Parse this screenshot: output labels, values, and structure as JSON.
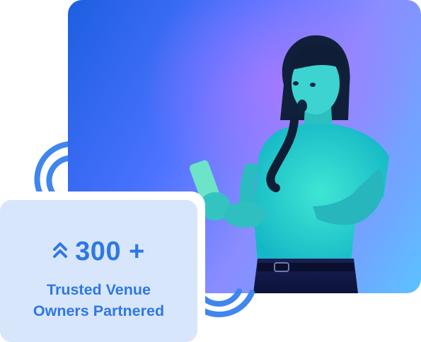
{
  "colors": {
    "accent": "#2f78e4",
    "card_background": "#d8e6fc",
    "arc": "#3f86ee"
  },
  "photo": {
    "icon": "surprised-woman-with-phone-photo"
  },
  "stats": {
    "icon": "double-chevron-up-icon",
    "value": "300 +",
    "caption_line1": "Trusted Venue",
    "caption_line2": "Owners Partnered"
  }
}
